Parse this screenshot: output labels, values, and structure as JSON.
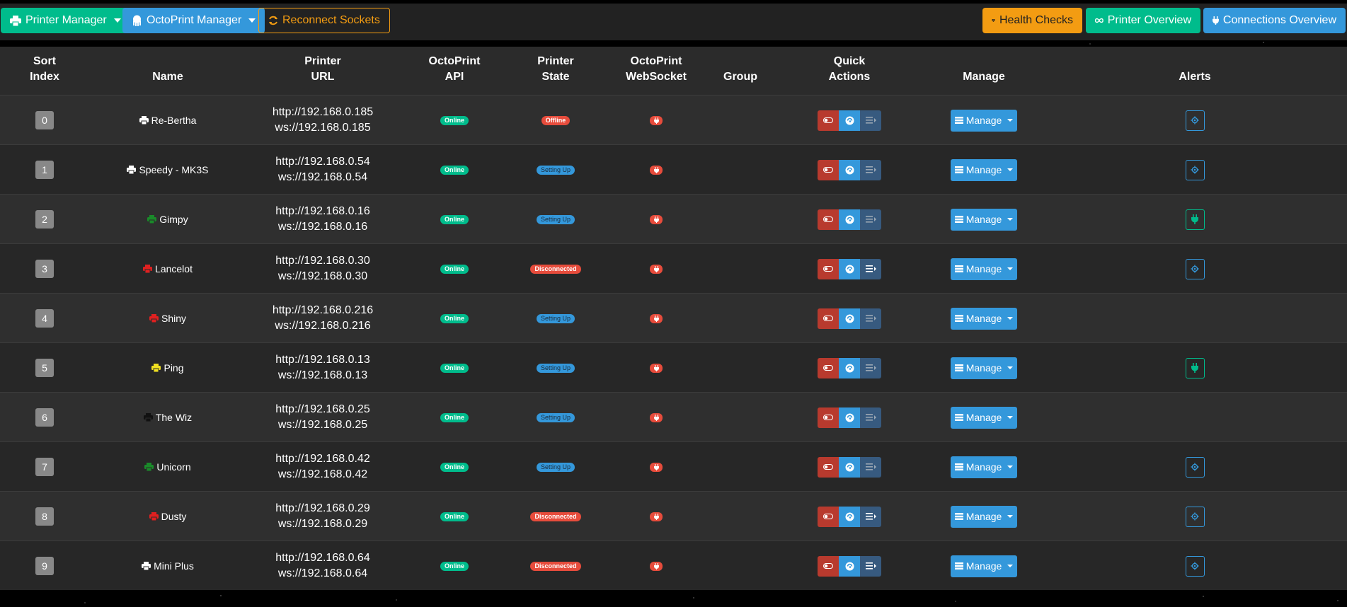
{
  "toolbar": {
    "printer_manager": "Printer Manager",
    "octoprint_manager": "OctoPrint Manager",
    "reconnect_sockets": "Reconnect Sockets",
    "health_checks": "Health Checks",
    "printer_overview": "Printer Overview",
    "connections_overview": "Connections Overview"
  },
  "table": {
    "headers": {
      "sort_index": [
        "Sort",
        "Index"
      ],
      "name": "Name",
      "printer_url": [
        "Printer",
        "URL"
      ],
      "octoprint_api": [
        "OctoPrint",
        "API"
      ],
      "printer_state": [
        "Printer",
        "State"
      ],
      "octoprint_websocket": [
        "OctoPrint",
        "WebSocket"
      ],
      "group": "Group",
      "quick_actions": [
        "Quick",
        "Actions"
      ],
      "manage": "Manage",
      "alerts": "Alerts"
    },
    "manage_label": "Manage",
    "rows": [
      {
        "index": "0",
        "name": "Re-Bertha",
        "icon_color": "#ffffff",
        "http": "http://192.168.0.185",
        "ws": "ws://192.168.0.185",
        "api": "Online",
        "state": "Offline",
        "state_kind": "red",
        "q3_active": false,
        "alert": "gear"
      },
      {
        "index": "1",
        "name": "Speedy - MK3S",
        "icon_color": "#ffffff",
        "http": "http://192.168.0.54",
        "ws": "ws://192.168.0.54",
        "api": "Online",
        "state": "Setting Up",
        "state_kind": "blue",
        "q3_active": false,
        "alert": "gear"
      },
      {
        "index": "2",
        "name": "Gimpy",
        "icon_color": "#1a8a2a",
        "http": "http://192.168.0.16",
        "ws": "ws://192.168.0.16",
        "api": "Online",
        "state": "Setting Up",
        "state_kind": "blue",
        "q3_active": false,
        "alert": "plug"
      },
      {
        "index": "3",
        "name": "Lancelot",
        "icon_color": "#e02020",
        "http": "http://192.168.0.30",
        "ws": "ws://192.168.0.30",
        "api": "Online",
        "state": "Disconnected",
        "state_kind": "red",
        "q3_active": true,
        "alert": "gear"
      },
      {
        "index": "4",
        "name": "Shiny",
        "icon_color": "#e02020",
        "http": "http://192.168.0.216",
        "ws": "ws://192.168.0.216",
        "api": "Online",
        "state": "Setting Up",
        "state_kind": "blue",
        "q3_active": false,
        "alert": "none"
      },
      {
        "index": "5",
        "name": "Ping",
        "icon_color": "#f0e020",
        "http": "http://192.168.0.13",
        "ws": "ws://192.168.0.13",
        "api": "Online",
        "state": "Setting Up",
        "state_kind": "blue",
        "q3_active": false,
        "alert": "plug"
      },
      {
        "index": "6",
        "name": "The Wiz",
        "icon_color": "#111111",
        "http": "http://192.168.0.25",
        "ws": "ws://192.168.0.25",
        "api": "Online",
        "state": "Setting Up",
        "state_kind": "blue",
        "q3_active": false,
        "alert": "none"
      },
      {
        "index": "7",
        "name": "Unicorn",
        "icon_color": "#1a8a2a",
        "http": "http://192.168.0.42",
        "ws": "ws://192.168.0.42",
        "api": "Online",
        "state": "Setting Up",
        "state_kind": "blue",
        "q3_active": false,
        "alert": "gear"
      },
      {
        "index": "8",
        "name": "Dusty",
        "icon_color": "#e02020",
        "http": "http://192.168.0.29",
        "ws": "ws://192.168.0.29",
        "api": "Online",
        "state": "Disconnected",
        "state_kind": "red",
        "q3_active": true,
        "alert": "gear"
      },
      {
        "index": "9",
        "name": "Mini Plus",
        "icon_color": "#ffffff",
        "http": "http://192.168.0.64",
        "ws": "ws://192.168.0.64",
        "api": "Online",
        "state": "Disconnected",
        "state_kind": "red",
        "q3_active": true,
        "alert": "gear"
      }
    ]
  }
}
